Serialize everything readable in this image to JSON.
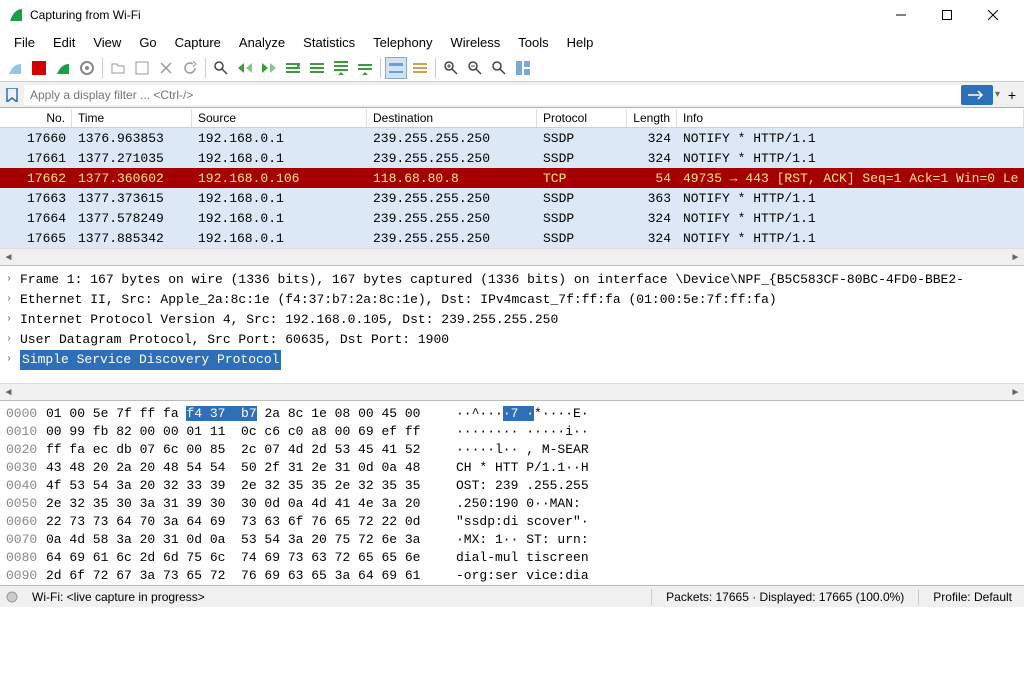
{
  "window": {
    "title": "Capturing from Wi-Fi"
  },
  "menu": [
    "File",
    "Edit",
    "View",
    "Go",
    "Capture",
    "Analyze",
    "Statistics",
    "Telephony",
    "Wireless",
    "Tools",
    "Help"
  ],
  "filter": {
    "placeholder": "Apply a display filter ... <Ctrl-/>"
  },
  "columns": {
    "no": "No.",
    "time": "Time",
    "src": "Source",
    "dst": "Destination",
    "proto": "Protocol",
    "len": "Length",
    "info": "Info"
  },
  "packets": [
    {
      "no": "17660",
      "time": "1376.963853",
      "src": "192.168.0.1",
      "dst": "239.255.255.250",
      "proto": "SSDP",
      "len": "324",
      "info": "NOTIFY * HTTP/1.1",
      "cls": "blue"
    },
    {
      "no": "17661",
      "time": "1377.271035",
      "src": "192.168.0.1",
      "dst": "239.255.255.250",
      "proto": "SSDP",
      "len": "324",
      "info": "NOTIFY * HTTP/1.1",
      "cls": "blue"
    },
    {
      "no": "17662",
      "time": "1377.360602",
      "src": "192.168.0.106",
      "dst": "118.68.80.8",
      "proto": "TCP",
      "len": "54",
      "info": "49735 → 443 [RST, ACK] Seq=1 Ack=1 Win=0 Le",
      "cls": "red"
    },
    {
      "no": "17663",
      "time": "1377.373615",
      "src": "192.168.0.1",
      "dst": "239.255.255.250",
      "proto": "SSDP",
      "len": "363",
      "info": "NOTIFY * HTTP/1.1",
      "cls": "blue"
    },
    {
      "no": "17664",
      "time": "1377.578249",
      "src": "192.168.0.1",
      "dst": "239.255.255.250",
      "proto": "SSDP",
      "len": "324",
      "info": "NOTIFY * HTTP/1.1",
      "cls": "blue"
    },
    {
      "no": "17665",
      "time": "1377.885342",
      "src": "192.168.0.1",
      "dst": "239.255.255.250",
      "proto": "SSDP",
      "len": "324",
      "info": "NOTIFY * HTTP/1.1",
      "cls": "blue"
    }
  ],
  "details": {
    "l0": "Frame 1: 167 bytes on wire (1336 bits), 167 bytes captured (1336 bits) on interface \\Device\\NPF_{B5C583CF-80BC-4FD0-BBE2-",
    "l1": "Ethernet II, Src: Apple_2a:8c:1e (f4:37:b7:2a:8c:1e), Dst: IPv4mcast_7f:ff:fa (01:00:5e:7f:ff:fa)",
    "l2": "Internet Protocol Version 4, Src: 192.168.0.105, Dst: 239.255.255.250",
    "l3": "User Datagram Protocol, Src Port: 60635, Dst Port: 1900",
    "l4": "Simple Service Discovery Protocol"
  },
  "hex": [
    {
      "off": "0000",
      "b1": "01 00 5e 7f ff fa ",
      "bh": "f4 37  b7",
      "b2": " 2a 8c 1e 08 00 45 00",
      "a1": "··^···",
      "ah": "·7 ·",
      "a2": "*····E·"
    },
    {
      "off": "0010",
      "b": "00 99 fb 82 00 00 01 11  0c c6 c0 a8 00 69 ef ff",
      "a": "········ ·····i··"
    },
    {
      "off": "0020",
      "b": "ff fa ec db 07 6c 00 85  2c 07 4d 2d 53 45 41 52",
      "a": "·····l·· , M-SEAR"
    },
    {
      "off": "0030",
      "b": "43 48 20 2a 20 48 54 54  50 2f 31 2e 31 0d 0a 48",
      "a": "CH * HTT P/1.1··H"
    },
    {
      "off": "0040",
      "b": "4f 53 54 3a 20 32 33 39  2e 32 35 35 2e 32 35 35",
      "a": "OST: 239 .255.255"
    },
    {
      "off": "0050",
      "b": "2e 32 35 30 3a 31 39 30  30 0d 0a 4d 41 4e 3a 20",
      "a": ".250:190 0··MAN: "
    },
    {
      "off": "0060",
      "b": "22 73 73 64 70 3a 64 69  73 63 6f 76 65 72 22 0d",
      "a": "\"ssdp:di scover\"·"
    },
    {
      "off": "0070",
      "b": "0a 4d 58 3a 20 31 0d 0a  53 54 3a 20 75 72 6e 3a",
      "a": "·MX: 1·· ST: urn:"
    },
    {
      "off": "0080",
      "b": "64 69 61 6c 2d 6d 75 6c  74 69 73 63 72 65 65 6e",
      "a": "dial-mul tiscreen"
    },
    {
      "off": "0090",
      "b": "2d 6f 72 67 3a 73 65 72  76 69 63 65 3a 64 69 61",
      "a": "-org:ser vice:dia"
    }
  ],
  "status": {
    "left": "Wi-Fi: <live capture in progress>",
    "center": "Packets: 17665 · Displayed: 17665 (100.0%)",
    "right": "Profile: Default"
  }
}
